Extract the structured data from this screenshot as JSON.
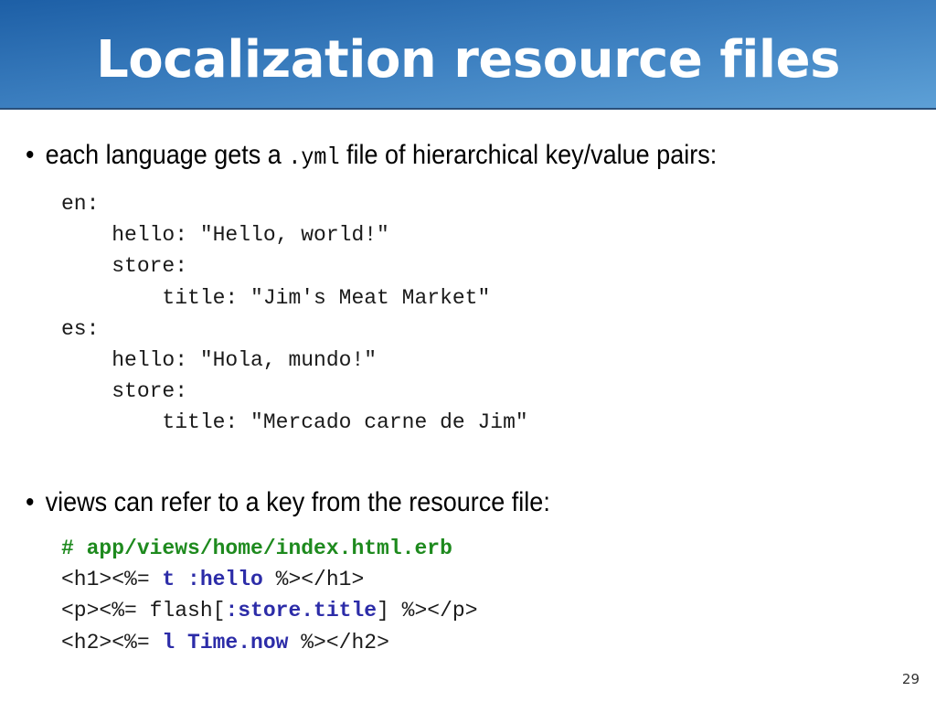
{
  "slide": {
    "title": "Localization resource files",
    "page_number": "29"
  },
  "bullets": [
    {
      "symbol": "•",
      "text_before": "each language gets a",
      "code": ".yml",
      "text_after": "file of hierarchical key/value pairs:"
    },
    {
      "symbol": "•",
      "text": "views can refer to a key from the resource file:"
    }
  ],
  "yml_code": {
    "lines": [
      "en:",
      "    hello: \"Hello, world!\"",
      "    store:",
      "        title: \"Jim's Meat Market\"",
      "es:",
      "    hello: \"Hola, mundo!\"",
      "    store:",
      "        title: \"Mercado carne de Jim\""
    ]
  },
  "erb_code": {
    "comment": "# app/views/home/index.html.erb",
    "line1": {
      "a": "<h1><%= ",
      "b": "t :hello",
      "c": " %></h1>"
    },
    "line2": {
      "a": "<p><%= flash[",
      "b": ":store.title",
      "c": "] %></p>"
    },
    "line3": {
      "a": "<h2><%= ",
      "b": "l Time.now",
      "c": " %></h2>"
    }
  },
  "colors": {
    "title_bar": "#3f82c2",
    "code_keyword": "#2c2ca8",
    "code_comment": "#1e8a1e"
  }
}
